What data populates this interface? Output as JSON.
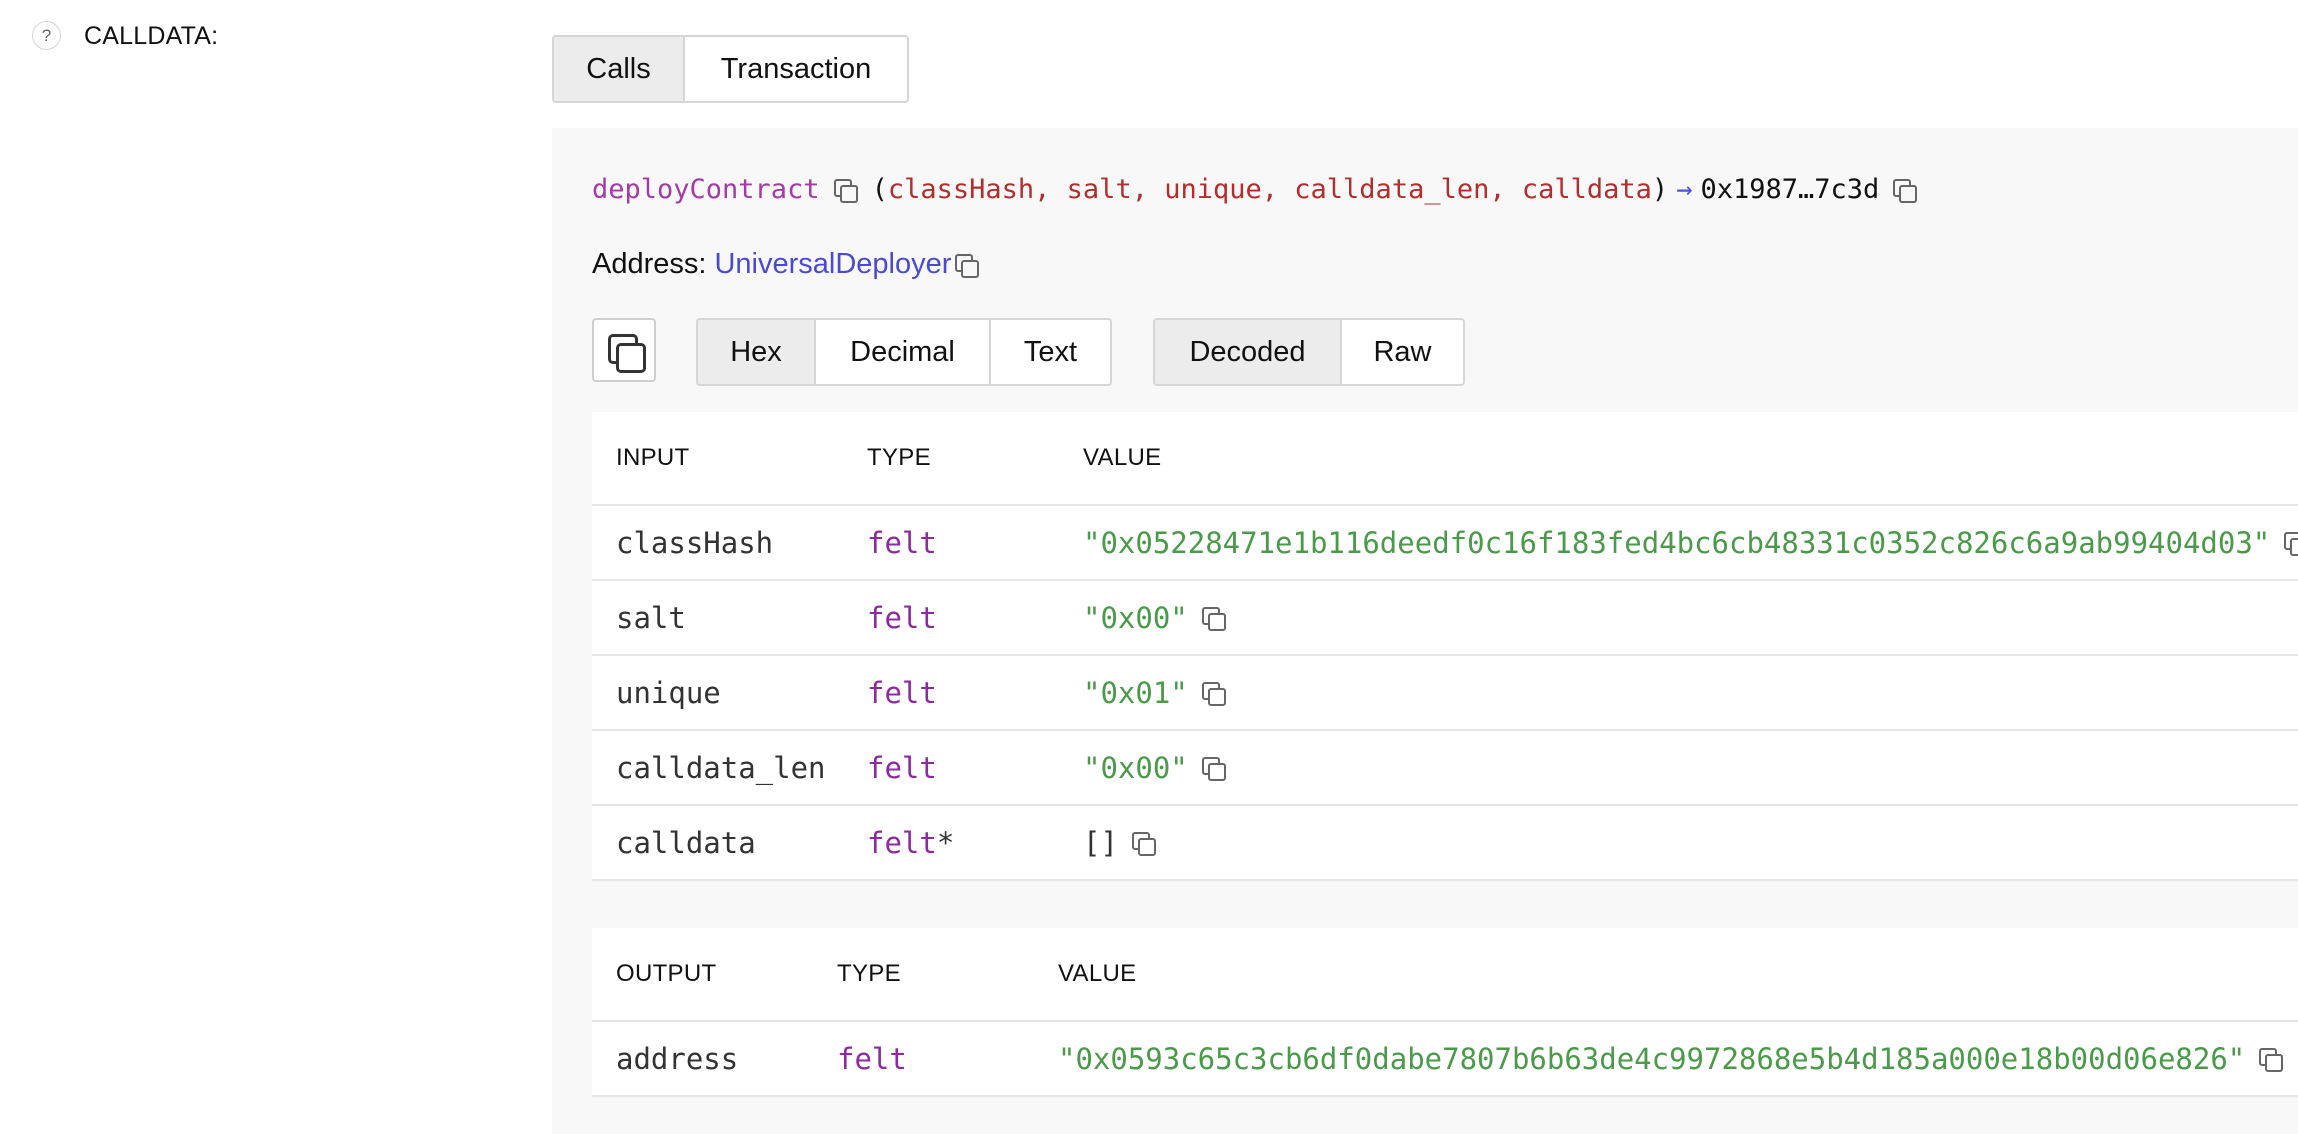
{
  "header": {
    "help_icon": "?",
    "label": "CALLDATA:"
  },
  "tabs": [
    {
      "label": "Calls",
      "active": true
    },
    {
      "label": "Transaction",
      "active": false
    }
  ],
  "call": {
    "function": "deployContract",
    "paren_open": "(",
    "params": [
      "classHash,",
      "salt,",
      "unique,",
      "calldata_len,",
      "calldata"
    ],
    "paren_close": ")",
    "arrow": "→",
    "return_value": "0x1987…7c3d",
    "address_label": "Address:",
    "address_link": "UniversalDeployer"
  },
  "format_buttons": [
    {
      "label": "Hex",
      "active": true
    },
    {
      "label": "Decimal",
      "active": false
    },
    {
      "label": "Text",
      "active": false
    }
  ],
  "mode_buttons": [
    {
      "label": "Decoded",
      "active": true
    },
    {
      "label": "Raw",
      "active": false
    }
  ],
  "inputs": {
    "headers": [
      "INPUT",
      "TYPE",
      "VALUE"
    ],
    "rows": [
      {
        "name": "classHash",
        "type": "felt",
        "value": "\"0x05228471e1b116deedf0c16f183fed4bc6cb48331c0352c826c6a9ab99404d03\""
      },
      {
        "name": "salt",
        "type": "felt",
        "value": "\"0x00\""
      },
      {
        "name": "unique",
        "type": "felt",
        "value": "\"0x01\""
      },
      {
        "name": "calldata_len",
        "type": "felt",
        "value": "\"0x00\""
      },
      {
        "name": "calldata",
        "type": "felt",
        "type_suffix": "*",
        "value": "[]"
      }
    ]
  },
  "outputs": {
    "headers": [
      "OUTPUT",
      "TYPE",
      "VALUE"
    ],
    "rows": [
      {
        "name": "address",
        "type": "felt",
        "value": "\"0x0593c65c3cb6df0dabe7807b6b63de4c9972868e5b4d185a000e18b00d06e826\""
      }
    ]
  },
  "colors": {
    "function": "#a23ba8",
    "param": "#b22d2d",
    "type": "#8c2aa0",
    "value": "#4a9a4a",
    "link": "#4a4ad0"
  }
}
